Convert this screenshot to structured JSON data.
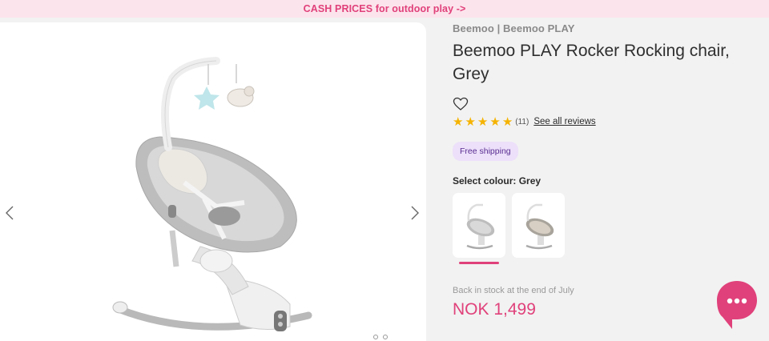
{
  "promo": {
    "text": "CASH PRICES for outdoor play ->"
  },
  "gallery": {
    "prev_icon": "chevron-left-icon",
    "next_icon": "chevron-right-icon",
    "image_alt": "Beemoo PLAY Rocker Rocking chair, Grey"
  },
  "product": {
    "brand": "Beemoo | Beemoo PLAY",
    "title": "Beemoo PLAY Rocker Rocking chair, Grey",
    "rating": 5,
    "review_count": "(11)",
    "see_reviews": "See all reviews",
    "badge": "Free shipping",
    "colour_label": "Select colour: Grey",
    "colours": [
      "Grey",
      "Beige"
    ],
    "stock": "Back in stock at the end of July",
    "price": "NOK 1,499"
  },
  "colors": {
    "accent": "#e0417a",
    "star": "#f5b301",
    "badge_bg": "#ece0fa",
    "promo_bg": "#fce4ec"
  }
}
